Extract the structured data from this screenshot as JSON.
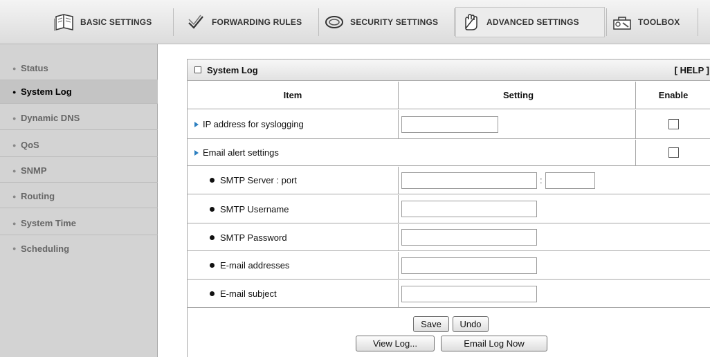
{
  "tabs": [
    {
      "label": "BASIC SETTINGS",
      "icon": "book-icon"
    },
    {
      "label": "FORWARDING RULES",
      "icon": "arrows-icon"
    },
    {
      "label": "SECURITY SETTINGS",
      "icon": "lock-ring-icon"
    },
    {
      "label": "ADVANCED SETTINGS",
      "icon": "hand-icon"
    },
    {
      "label": "TOOLBOX",
      "icon": "toolbox-icon"
    }
  ],
  "sidebar": {
    "items": [
      {
        "label": "Status"
      },
      {
        "label": "System Log"
      },
      {
        "label": "Dynamic DNS"
      },
      {
        "label": "QoS"
      },
      {
        "label": "SNMP"
      },
      {
        "label": "Routing"
      },
      {
        "label": "System Time"
      },
      {
        "label": "Scheduling"
      }
    ],
    "active": "System Log"
  },
  "panel": {
    "title": "System Log",
    "help": "[ HELP ]",
    "headers": {
      "item": "Item",
      "setting": "Setting",
      "enable": "Enable"
    },
    "rows": {
      "ip": {
        "label": "IP address for syslogging",
        "value": "",
        "enabled": false
      },
      "email_alert": {
        "label": "Email alert settings",
        "enabled": false
      },
      "smtp_server": {
        "label": "SMTP Server : port",
        "value": "",
        "port": "",
        "separator": ":"
      },
      "smtp_user": {
        "label": "SMTP Username",
        "value": ""
      },
      "smtp_pass": {
        "label": "SMTP Password",
        "value": ""
      },
      "email_addr": {
        "label": "E-mail addresses",
        "value": ""
      },
      "email_subj": {
        "label": "E-mail subject",
        "value": ""
      }
    },
    "buttons": {
      "save": "Save",
      "undo": "Undo",
      "view_log": "View Log...",
      "email_log": "Email Log Now"
    }
  },
  "colors": {
    "arrow": "#2c7fc0",
    "sidebar_bg": "#d3d3d3",
    "sidebar_active": "#c4c4c4"
  }
}
